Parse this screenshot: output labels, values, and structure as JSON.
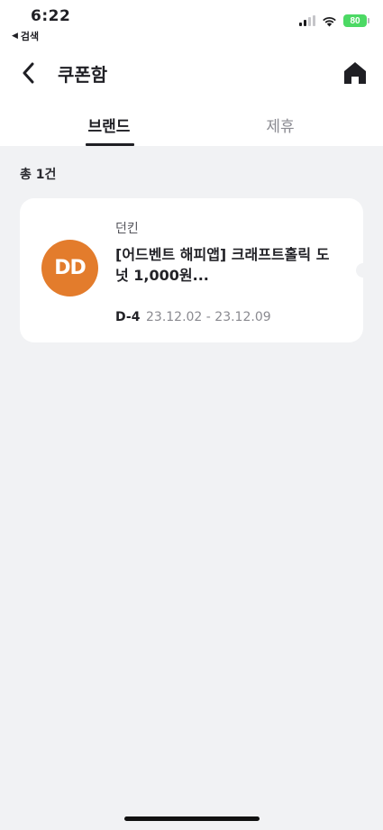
{
  "status_bar": {
    "time": "6:22",
    "back_app": "검색",
    "battery": "80"
  },
  "nav": {
    "title": "쿠폰함"
  },
  "tabs": [
    {
      "label": "브랜드",
      "active": true
    },
    {
      "label": "제휴",
      "active": false
    }
  ],
  "total": "총 1건",
  "coupons": [
    {
      "logo_text": "DD",
      "brand": "던킨",
      "title": "[어드벤트 해피앱] 크래프트홀릭 도넛 1,000원...",
      "dday": "D-4",
      "period": "23.12.02 - 23.12.09",
      "logo_color": "#e37c2c"
    }
  ],
  "colors": {
    "accent": "#1f1f24",
    "background": "#f1f2f4",
    "brand_orange": "#e37c2c"
  }
}
